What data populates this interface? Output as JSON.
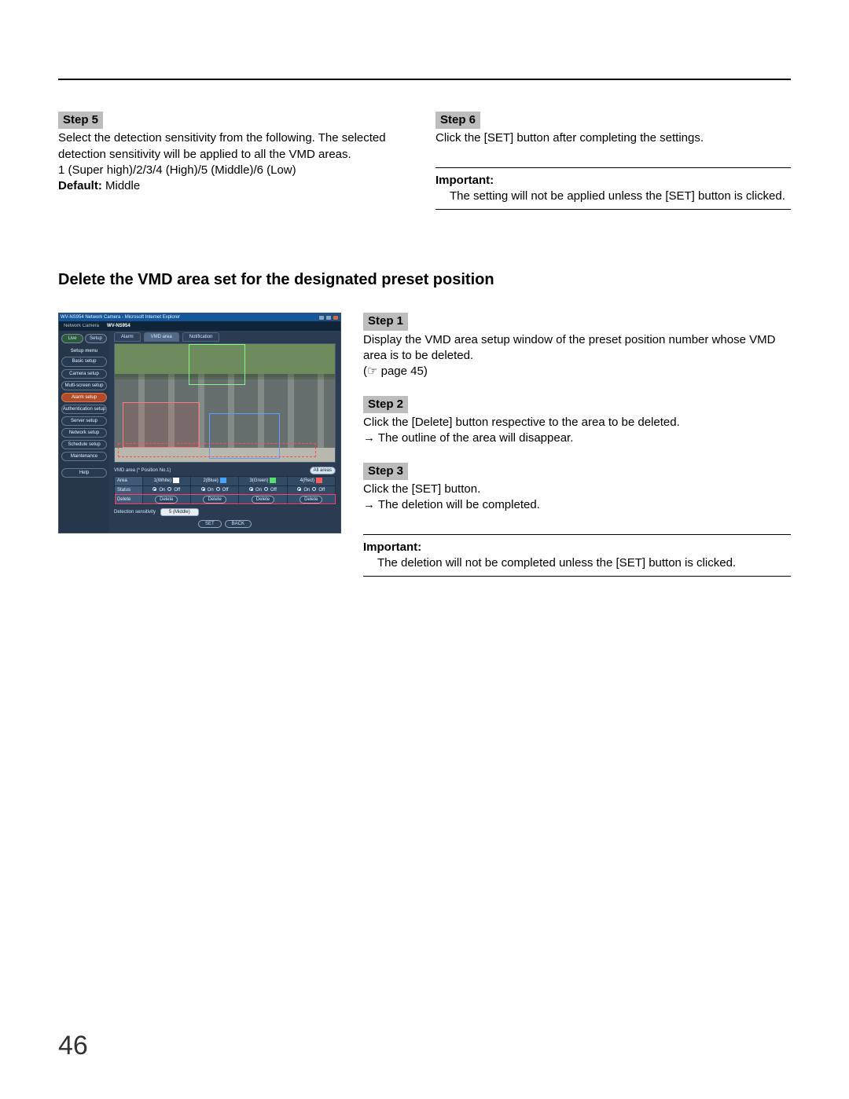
{
  "page_number": "46",
  "top": {
    "step5": {
      "label": "Step 5",
      "p1": "Select the detection sensitivity from the following. The selected detection sensitivity will be applied to all the VMD areas.",
      "p2": "1 (Super high)/2/3/4 (High)/5 (Middle)/6 (Low)",
      "default_label": "Default:",
      "default_value": " Middle"
    },
    "step6": {
      "label": "Step 6",
      "p1": "Click the [SET] button after completing the settings.",
      "important_label": "Important:",
      "important_text": "The setting will not be applied unless the [SET] button is clicked."
    }
  },
  "section_title": "Delete the VMD area set for the designated preset position",
  "right": {
    "step1": {
      "label": "Step 1",
      "p1": "Display the VMD area setup window of the preset position number whose VMD area is to be deleted.",
      "p2": "(☞ page 45)"
    },
    "step2": {
      "label": "Step 2",
      "p1": "Click the [Delete] button respective to the area to be deleted.",
      "p2": "→ The outline of the area will disappear."
    },
    "step3": {
      "label": "Step 3",
      "p1": "Click the [SET] button.",
      "p2": "→ The deletion will be completed."
    },
    "important_label": "Important:",
    "important_text": "The deletion will not be completed unless the [SET] button is clicked."
  },
  "shot": {
    "window_title": "WV-NS954 Network Camera - Microsoft Internet Explorer",
    "brand_sub": "Network Camera",
    "brand_model": "WV-NS954",
    "sidebar": {
      "live": "Live",
      "setup": "Setup",
      "menu_header": "Setup menu",
      "items": [
        "Basic setup",
        "Camera setup",
        "Multi-screen setup",
        "Alarm setup",
        "Authentication setup",
        "Server setup",
        "Network setup",
        "Schedule setup",
        "Maintenance"
      ],
      "help": "Help"
    },
    "tabs": {
      "alarm": "Alarm",
      "vmd": "VMD area",
      "notif": "Notification"
    },
    "cfg": {
      "title": "VMD area (* Position No.1)",
      "all_areas": "All areas",
      "row_labels": {
        "area": "Area",
        "status": "Status",
        "delete": "Delete",
        "sens": "Detection sensitivity"
      },
      "areas": [
        "1(White)",
        "2(Blue)",
        "3(Green)",
        "4(Red)"
      ],
      "on": "On",
      "off": "Off",
      "delete_btn": "Delete",
      "sens_value": "5 (Middle)",
      "set_btn": "SET",
      "back_btn": "BACK"
    }
  }
}
